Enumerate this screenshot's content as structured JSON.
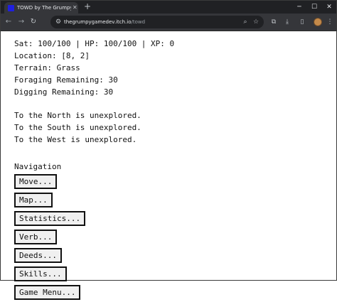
{
  "browser": {
    "tab_title": "TOWD by The Grumpy GameDev",
    "url_host": "thegrumpygamedev.itch.io",
    "url_path": "/towd"
  },
  "status": {
    "stats_line": "Sat: 100/100 | HP: 100/100 | XP: 0",
    "location": "Location: [8, 2]",
    "terrain": "Terrain: Grass",
    "foraging": "Foraging Remaining: 30",
    "digging": "Digging Remaining: 30"
  },
  "exploration": [
    "To the North is unexplored.",
    "To the South is unexplored.",
    "To the West is unexplored."
  ],
  "navigation": {
    "heading": "Navigation",
    "buttons": [
      "Move...",
      "Map...",
      "Statistics...",
      "Verb...",
      "Deeds...",
      "Skills...",
      "Game Menu..."
    ]
  }
}
